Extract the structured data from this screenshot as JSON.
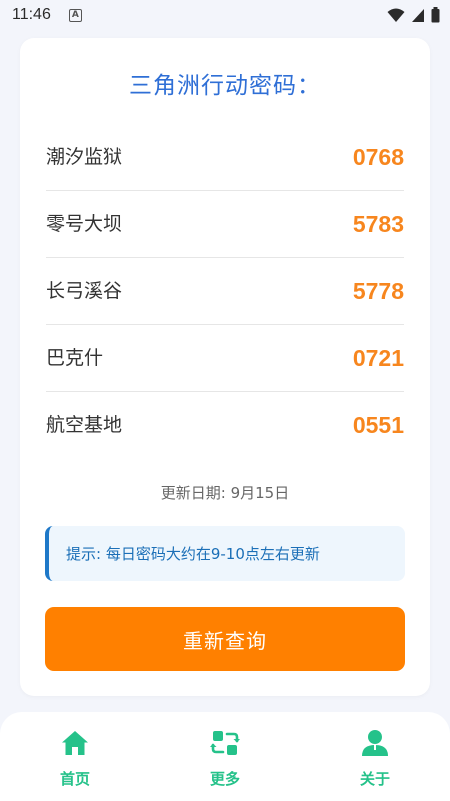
{
  "status_bar": {
    "time": "11:46",
    "indicator": "A"
  },
  "card": {
    "title": "三角洲行动密码：",
    "codes": [
      {
        "place": "潮汐监狱",
        "code": "0768"
      },
      {
        "place": "零号大坝",
        "code": "5783"
      },
      {
        "place": "长弓溪谷",
        "code": "5778"
      },
      {
        "place": "巴克什",
        "code": "0721"
      },
      {
        "place": "航空基地",
        "code": "0551"
      }
    ],
    "update_date": "更新日期: 9月15日",
    "tip": "提示: 每日密码大约在9-10点左右更新",
    "requery_label": "重新查询"
  },
  "tabs": [
    {
      "label": "首页",
      "icon": "home-icon"
    },
    {
      "label": "更多",
      "icon": "refresh-icon"
    },
    {
      "label": "关于",
      "icon": "user-icon"
    }
  ],
  "colors": {
    "accent_orange": "#ff8000",
    "code_orange": "#f7861e",
    "title_blue": "#2f6fd6",
    "tab_green": "#25c28a",
    "tip_blue": "#1e78c8"
  }
}
